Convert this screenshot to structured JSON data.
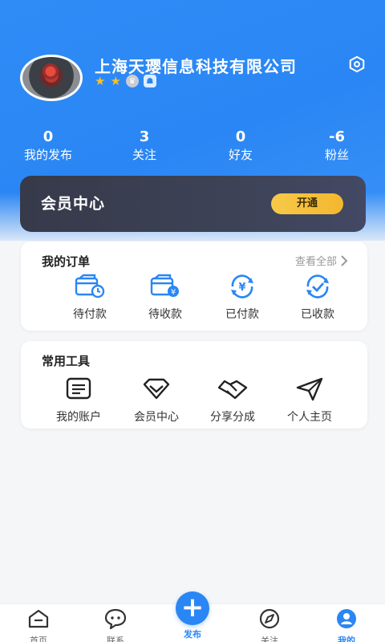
{
  "profile": {
    "name": "上海天璎信息科技有限公司",
    "stars": [
      "★",
      "★"
    ],
    "crown_glyph": "♛",
    "shield_glyph": "☗"
  },
  "stats": [
    {
      "value": "0",
      "label": "我的发布"
    },
    {
      "value": "3",
      "label": "关注"
    },
    {
      "value": "0",
      "label": "好友"
    },
    {
      "value": "-6",
      "label": "粉丝"
    }
  ],
  "vip": {
    "title": "会员中心",
    "button": "开通"
  },
  "orders": {
    "title": "我的订单",
    "view_all": "查看全部",
    "items": [
      {
        "label": "待付款",
        "icon": "wallet-clock-icon"
      },
      {
        "label": "待收款",
        "icon": "wallet-coin-icon"
      },
      {
        "label": "已付款",
        "icon": "yuan-refresh-icon"
      },
      {
        "label": "已收款",
        "icon": "check-refresh-icon"
      }
    ]
  },
  "tools": {
    "title": "常用工具",
    "items": [
      {
        "label": "我的账户",
        "icon": "document-icon"
      },
      {
        "label": "会员中心",
        "icon": "diamond-icon"
      },
      {
        "label": "分享分成",
        "icon": "handshake-icon"
      },
      {
        "label": "个人主页",
        "icon": "send-icon"
      }
    ]
  },
  "tabbar": {
    "items": [
      {
        "label": "首页",
        "icon": "home-icon"
      },
      {
        "label": "联系",
        "icon": "chat-icon"
      },
      {
        "label": "发布",
        "icon": "plus-icon"
      },
      {
        "label": "关注",
        "icon": "compass-icon"
      },
      {
        "label": "我的",
        "icon": "user-icon"
      }
    ],
    "fab_glyph": "+"
  },
  "colors": {
    "primary": "#2a86f4",
    "vip_bg": "#3d4256",
    "vip_button": "#f3b72e",
    "star": "#f6c02f"
  }
}
